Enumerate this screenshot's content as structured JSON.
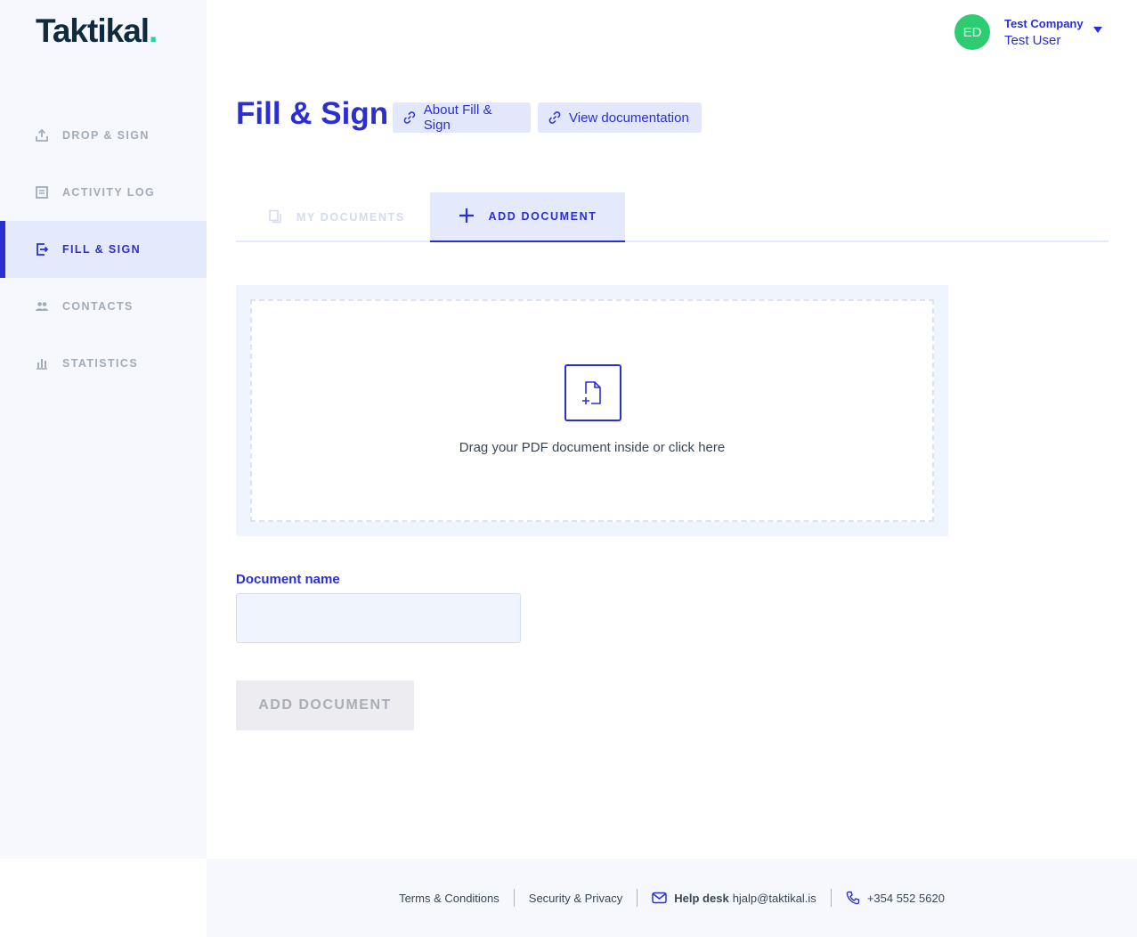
{
  "brand": {
    "name": "Taktikal",
    "dot": ".",
    "dot_color": "#27d4a0"
  },
  "colors": {
    "accent": "#2b2fd3",
    "avatar": "#2ecc71",
    "sidebar_bg": "#f6f8fd"
  },
  "sidebar": {
    "items": [
      {
        "label": "DROP & SIGN",
        "icon": "upload-icon",
        "active": false
      },
      {
        "label": "ACTIVITY LOG",
        "icon": "document-list-icon",
        "active": false
      },
      {
        "label": "FILL & SIGN",
        "icon": "fill-sign-icon",
        "active": true
      },
      {
        "label": "CONTACTS",
        "icon": "people-icon",
        "active": false
      },
      {
        "label": "STATISTICS",
        "icon": "bar-chart-icon",
        "active": false
      }
    ]
  },
  "user": {
    "initials": "ED",
    "company": "Test Company",
    "name": "Test User"
  },
  "page": {
    "title": "Fill & Sign",
    "about_link": "About Fill & Sign",
    "docs_link": "View documentation"
  },
  "tabs": [
    {
      "label": "MY DOCUMENTS",
      "icon": "documents-icon",
      "active": false
    },
    {
      "label": "ADD DOCUMENT",
      "icon": "plus-icon",
      "active": true
    }
  ],
  "dropzone": {
    "icon": "add-file-icon",
    "text": "Drag your PDF document inside or click here"
  },
  "form": {
    "document_name_label": "Document name",
    "document_name_value": "",
    "submit_label": "ADD DOCUMENT"
  },
  "footer": {
    "terms": "Terms & Conditions",
    "privacy": "Security & Privacy",
    "helpdesk_label": "Help desk",
    "helpdesk_email": "hjalp@taktikal.is",
    "phone": "+354 552 5620"
  }
}
